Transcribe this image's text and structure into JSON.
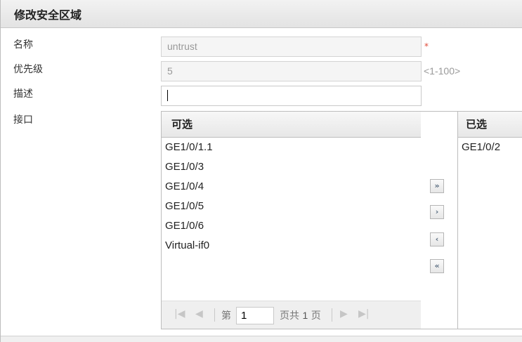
{
  "dialog": {
    "title": "修改安全区域"
  },
  "form": {
    "name_label": "名称",
    "name_value": "untrust",
    "required_mark": "*",
    "priority_label": "优先级",
    "priority_value": "5",
    "priority_hint": "<1-100>",
    "description_label": "描述",
    "description_value": "",
    "interface_label": "接口"
  },
  "available": {
    "header": "可选",
    "items": [
      "GE1/0/1.1",
      "GE1/0/3",
      "GE1/0/4",
      "GE1/0/5",
      "GE1/0/6",
      "Virtual-if0"
    ]
  },
  "pager": {
    "page_prefix": "第",
    "current_page": "1",
    "page_suffix": "页共",
    "total_pages": "1",
    "total_suffix": "页",
    "icons": [
      "first-page-icon",
      "prev-page-icon",
      "next-page-icon",
      "last-page-icon"
    ]
  },
  "move_buttons": {
    "add_all": "»",
    "add": "›",
    "remove": "‹",
    "remove_all": "«"
  },
  "selected": {
    "header": "已选",
    "items": [
      "GE1/0/2"
    ]
  },
  "colors": {
    "required": "#e04b3a",
    "hint": "#9a9a9a",
    "button_arrow": "#5b6e82"
  }
}
